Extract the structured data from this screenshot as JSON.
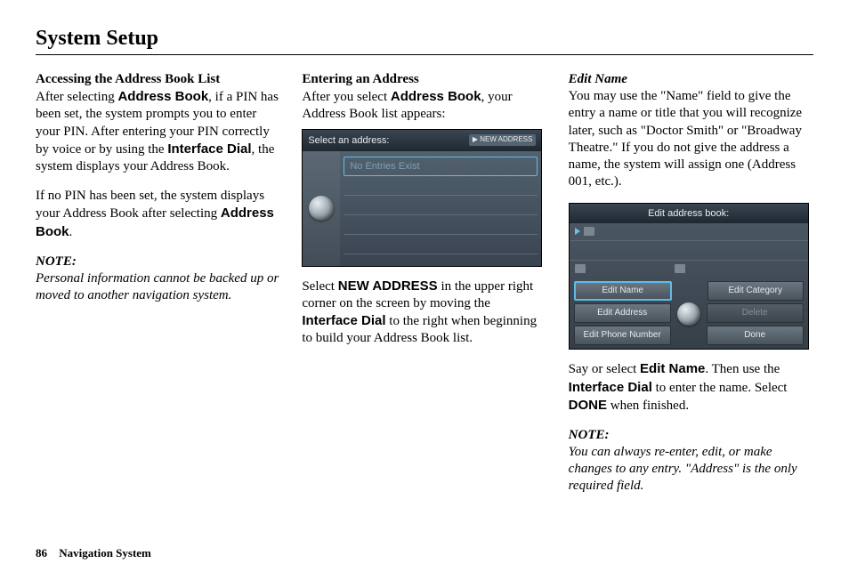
{
  "page_title": "System Setup",
  "footer": {
    "page_number": "86",
    "manual_name": "Navigation System"
  },
  "col1": {
    "heading": "Accessing the Address Book List",
    "p1a": "After selecting ",
    "p1b": ", if a PIN has been set, the system prompts you to enter your PIN. After entering your PIN correctly by voice or by using the ",
    "p1c": ", the system displays your Address Book.",
    "bold1": "Address Book",
    "bold2": "Interface Dial",
    "p2a": "If no PIN has been set, the system displays your Address Book after selecting ",
    "p2b": ".",
    "bold3": "Address Book",
    "note_label": "NOTE:",
    "note_body": "Personal information cannot be backed up or moved to another navigation system."
  },
  "col2": {
    "heading": "Entering an Address",
    "p1a": "After you select ",
    "p1b": ", your Address Book list appears:",
    "bold1": "Address Book",
    "screen": {
      "title": "Select an address:",
      "badge": "▶ NEW ADDRESS",
      "row1": "No Entries Exist"
    },
    "p2a": "Select ",
    "p2b": " in the upper right corner on the screen by moving the ",
    "p2c": " to the right when beginning to build your Address Book list.",
    "bold2": "NEW ADDRESS",
    "bold3": "Interface Dial"
  },
  "col3": {
    "heading": "Edit Name",
    "p1": "You may use the \"Name\" field to give the entry a name or title that you will recognize later, such as \"Doctor Smith\" or \"Broadway Theatre.\" If you do not give the address a name, the system will assign one (Address 001, etc.).",
    "screen": {
      "title": "Edit address book:",
      "buttons": {
        "edit_name": "Edit Name",
        "edit_category": "Edit Category",
        "edit_address": "Edit Address",
        "delete": "Delete",
        "edit_phone": "Edit Phone Number",
        "done": "Done"
      }
    },
    "p2a": "Say or select ",
    "p2b": ". Then use the ",
    "p2c": " to enter the name. Select ",
    "p2d": " when finished.",
    "bold1": "Edit Name",
    "bold2": "Interface Dial",
    "bold3": "DONE",
    "note_label": "NOTE:",
    "note_body": "You can always re-enter, edit, or make changes to any entry. \"Address\" is the only required field."
  }
}
